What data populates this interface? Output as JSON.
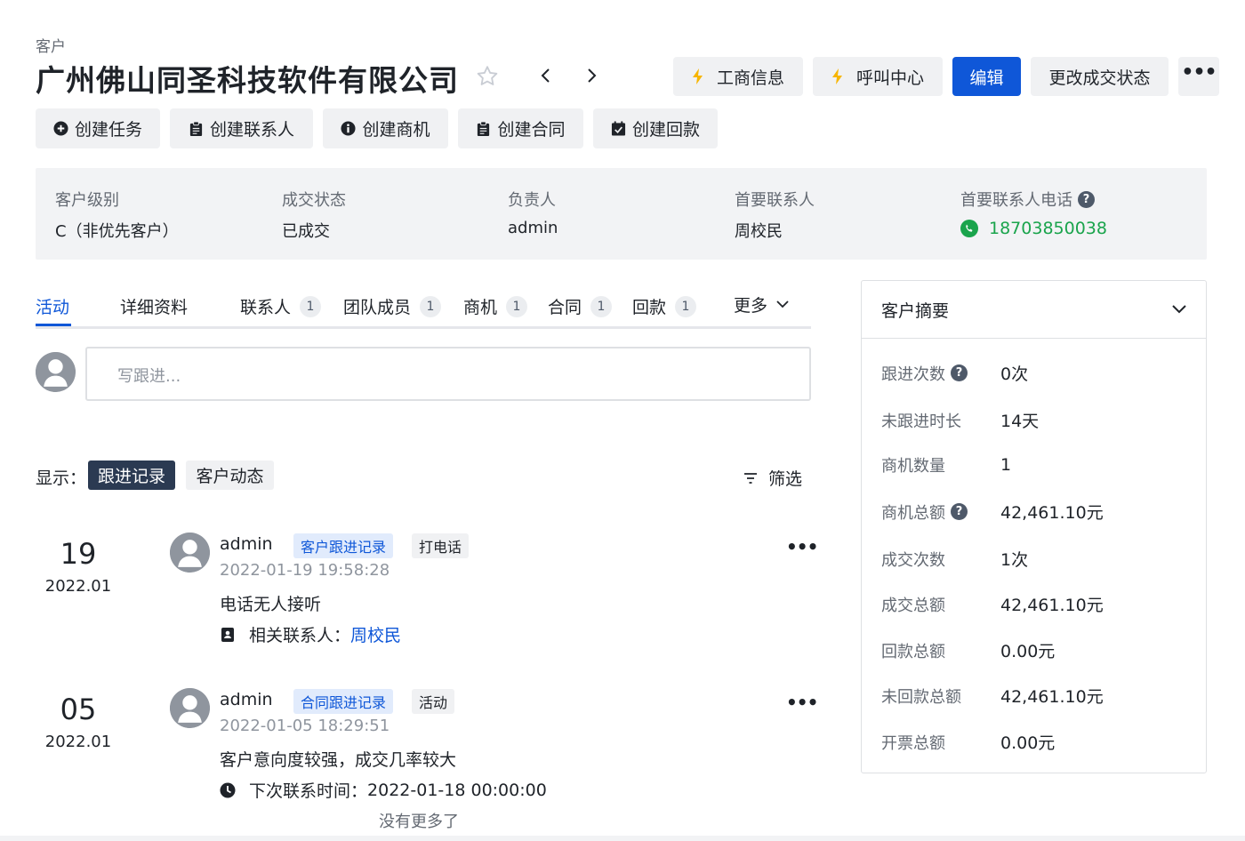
{
  "header": {
    "breadcrumb": "客户",
    "title": "广州佛山同圣科技软件有限公司",
    "buttons": {
      "business_info": "工商信息",
      "call_center": "呼叫中心",
      "edit": "编辑",
      "change_status": "更改成交状态",
      "more": "•••"
    }
  },
  "create_buttons": {
    "task": "创建任务",
    "contact": "创建联系人",
    "opportunity": "创建商机",
    "contract": "创建合同",
    "payment": "创建回款"
  },
  "info": {
    "level_label": "客户级别",
    "level_value": "C（非优先客户）",
    "status_label": "成交状态",
    "status_value": "已成交",
    "owner_label": "负责人",
    "owner_value": "admin",
    "contact_label": "首要联系人",
    "contact_value": "周校民",
    "phone_label": "首要联系人电话",
    "phone_value": "18703850038"
  },
  "tabs": {
    "activity": "活动",
    "details": "详细资料",
    "contacts": "联系人",
    "contacts_count": "1",
    "team": "团队成员",
    "team_count": "1",
    "opportunities": "商机",
    "opportunities_count": "1",
    "contracts": "合同",
    "contracts_count": "1",
    "payments": "回款",
    "payments_count": "1",
    "more": "更多"
  },
  "composer": {
    "placeholder": "写跟进..."
  },
  "display": {
    "label": "显示：",
    "followups": "跟进记录",
    "dynamics": "客户动态",
    "filter": "筛选"
  },
  "entries": [
    {
      "day": "19",
      "month": "2022.01",
      "author": "admin",
      "tag1": "客户跟进记录",
      "tag2": "打电话",
      "time": "2022-01-19 19:58:28",
      "content": "电话无人接听",
      "meta_label": "相关联系人：",
      "meta_value": "周校民",
      "more": "•••"
    },
    {
      "day": "05",
      "month": "2022.01",
      "author": "admin",
      "tag1": "合同跟进记录",
      "tag2": "活动",
      "time": "2022-01-05 18:29:51",
      "content": "客户意向度较强，成交几率较大",
      "meta_label": "下次联系时间：",
      "meta_value": "2022-01-18 00:00:00",
      "more": "•••"
    }
  ],
  "no_more": "没有更多了",
  "summary": {
    "title": "客户摘要",
    "rows": [
      {
        "k": "跟进次数",
        "v": "0次"
      },
      {
        "k": "未跟进时长",
        "v": "14天"
      },
      {
        "k": "商机数量",
        "v": "1"
      },
      {
        "k": "商机总额",
        "v": "42,461.10元"
      },
      {
        "k": "成交次数",
        "v": "1次"
      },
      {
        "k": "成交总额",
        "v": "42,461.10元"
      },
      {
        "k": "回款总额",
        "v": "0.00元"
      },
      {
        "k": "未回款总额",
        "v": "42,461.10元"
      },
      {
        "k": "开票总额",
        "v": "0.00元"
      }
    ]
  },
  "colors": {
    "primary": "#0f57d8",
    "phone_green": "#1aa44c",
    "dark_pill": "#2b3a52",
    "bolt": "#f7b500"
  },
  "icons": [
    "star-icon",
    "chevron-left-icon",
    "chevron-right-icon",
    "lightning-icon",
    "plus-circle-icon",
    "clipboard-icon",
    "info-icon",
    "calendar-check-icon",
    "help-icon",
    "phone-icon",
    "user-avatar-icon",
    "filter-icon",
    "contact-card-icon",
    "clock-icon",
    "chevron-down-icon"
  ]
}
